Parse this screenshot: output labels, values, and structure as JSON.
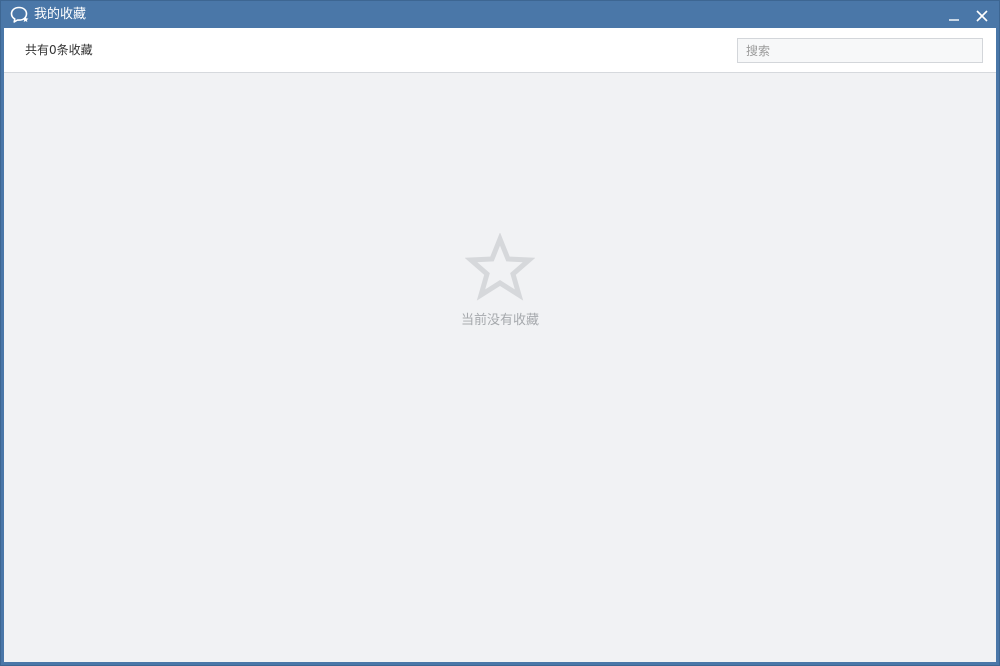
{
  "window": {
    "title": "我的收藏",
    "app_icon": "chat-bubble-icon",
    "controls": {
      "minimize_icon": "minimize-icon",
      "close_icon": "close-icon"
    }
  },
  "toolbar": {
    "count_text": "共有0条收藏",
    "search": {
      "placeholder": "搜索",
      "value": "",
      "icon": "search-field"
    }
  },
  "empty_state": {
    "icon": "star-outline-icon",
    "message": "当前没有收藏"
  },
  "colors": {
    "titlebar": "#4a77a8",
    "content_background": "#f1f2f4",
    "toolbar_background": "#ffffff",
    "empty_text": "#a6a9ad",
    "star": "#d6d8db"
  }
}
